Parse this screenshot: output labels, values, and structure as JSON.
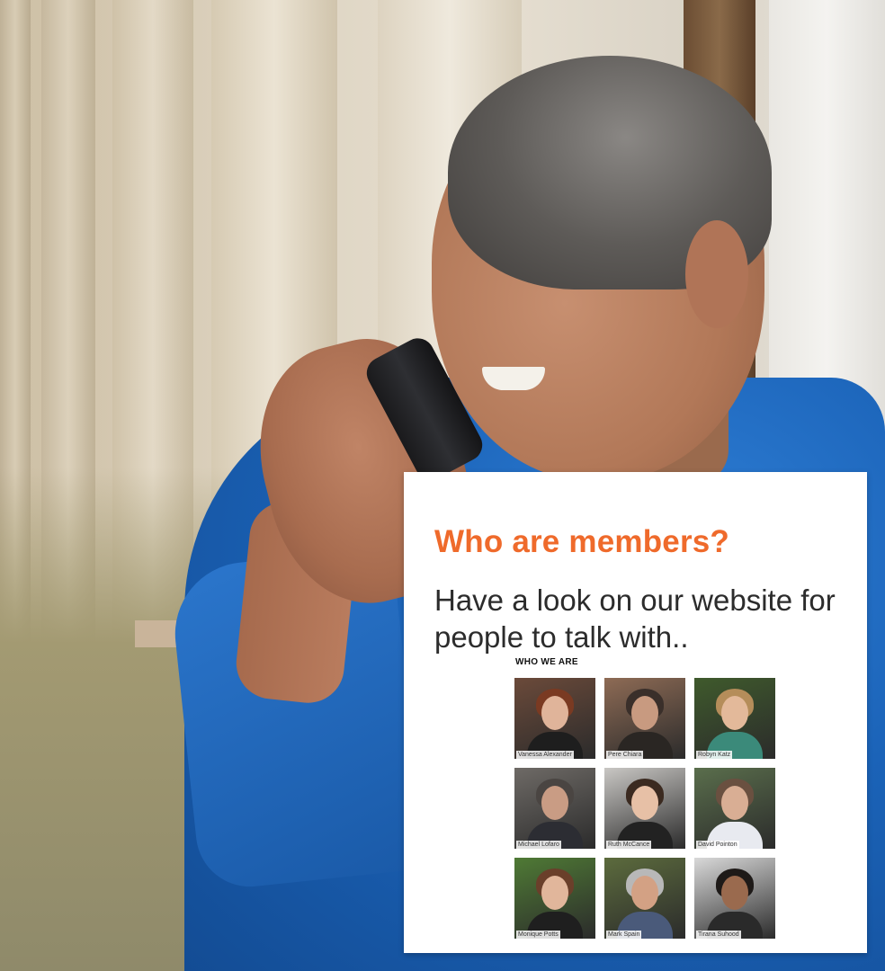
{
  "card": {
    "title": "Who are members?",
    "text": "Have a look on our website for people to talk with..",
    "section_heading": "WHO WE ARE"
  },
  "members": [
    {
      "name": "Vanessa Alexander",
      "bg": "#6b4a3a",
      "hair": "#7a3a22",
      "face": "#e0b49a",
      "shirt": "#1e1e1e"
    },
    {
      "name": "Pere Chiara",
      "bg": "#8e6b55",
      "hair": "#3a2f2a",
      "face": "#c89a80",
      "shirt": "#2a2623"
    },
    {
      "name": "Robyn Katz",
      "bg": "#3f5a2c",
      "hair": "#b58d5a",
      "face": "#e3b99a",
      "shirt": "#3b8a7a"
    },
    {
      "name": "Michael Lofaro",
      "bg": "#6e6a66",
      "hair": "#4a4542",
      "face": "#c99c84",
      "shirt": "#2c2d33"
    },
    {
      "name": "Ruth McCance",
      "bg": "#c9c7c4",
      "hair": "#3b2a20",
      "face": "#e7c0a6",
      "shirt": "#222222"
    },
    {
      "name": "David Pointon",
      "bg": "#5a6e4c",
      "hair": "#6a5040",
      "face": "#d9ae94",
      "shirt": "#e8eaf0"
    },
    {
      "name": "Monique Potts",
      "bg": "#4f7a35",
      "hair": "#6a3f2a",
      "face": "#e1b69b",
      "shirt": "#1f1f1f"
    },
    {
      "name": "Mark Spain",
      "bg": "#5c6b3d",
      "hair": "#b8b8b8",
      "face": "#d3a184",
      "shirt": "#4a5a7a"
    },
    {
      "name": "Tirana Suhood",
      "bg": "#d9d9d9",
      "hair": "#1e1a18",
      "face": "#9a6a4e",
      "shirt": "#2a2a2a"
    }
  ]
}
